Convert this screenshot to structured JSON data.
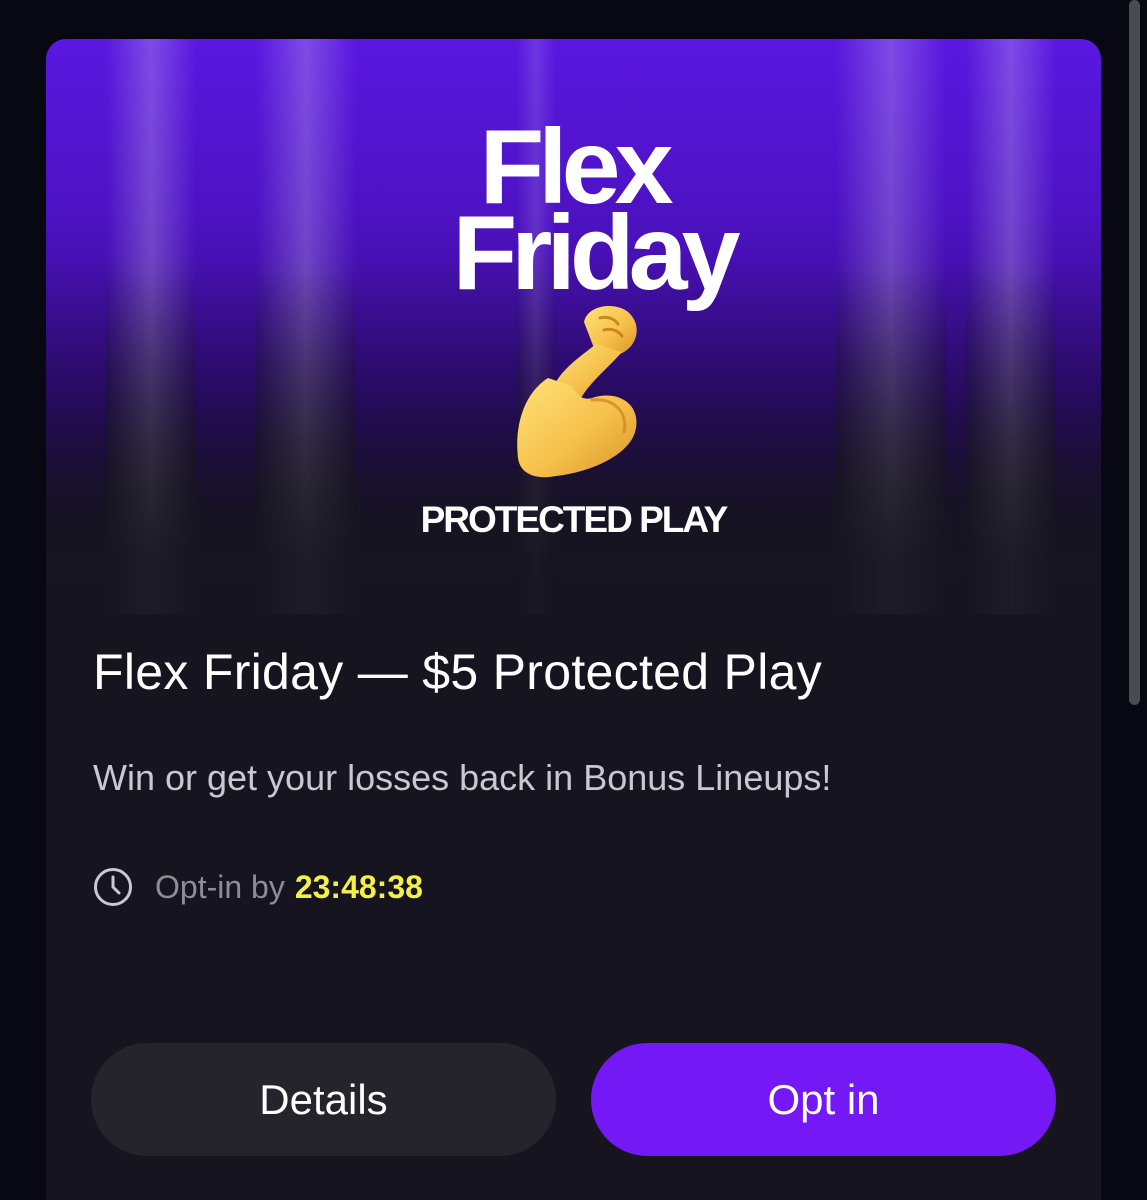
{
  "promo": {
    "banner": {
      "title_line1": "Flex",
      "title_line2": "Friday",
      "subtitle": "PROTECTED PLAY",
      "icon": "flexed-biceps-icon"
    },
    "title": "Flex Friday — $5 Protected Play",
    "description": "Win or get your losses back in Bonus Lineups!",
    "optin": {
      "icon": "clock-icon",
      "label": "Opt-in by",
      "countdown": "23:48:38"
    },
    "buttons": {
      "details": "Details",
      "opt_in": "Opt in"
    }
  },
  "colors": {
    "background": "#080812",
    "card": "#16151f",
    "banner_purple": "#5a18e0",
    "countdown": "#f4f04a",
    "primary_button": "#7418f5",
    "secondary_button": "#25242d"
  }
}
